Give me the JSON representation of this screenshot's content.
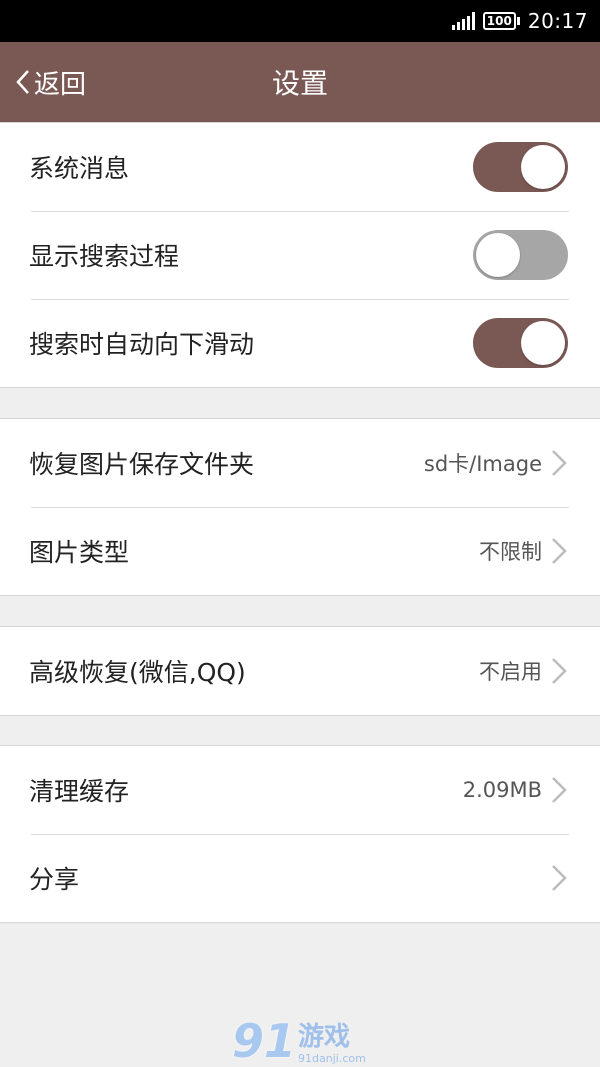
{
  "status_bar": {
    "battery": "100",
    "time": "20:17"
  },
  "navbar": {
    "back_label": "返回",
    "title": "设置"
  },
  "colors": {
    "accent": "#7a5955",
    "toggle_off": "#a6a6a6",
    "background": "#efefef"
  },
  "groups": [
    {
      "rows": [
        {
          "label": "系统消息",
          "toggle": true
        },
        {
          "label": "显示搜索过程",
          "toggle": false
        },
        {
          "label": "搜索时自动向下滑动",
          "toggle": true
        }
      ]
    },
    {
      "rows": [
        {
          "label": "恢复图片保存文件夹",
          "value": "sd卡/Image"
        },
        {
          "label": "图片类型",
          "value": "不限制"
        }
      ]
    },
    {
      "rows": [
        {
          "label": "高级恢复(微信,QQ)",
          "value": "不启用"
        }
      ]
    },
    {
      "rows": [
        {
          "label": "清理缓存",
          "value": "2.09MB"
        },
        {
          "label": "分享",
          "value": ""
        }
      ]
    }
  ],
  "watermark": {
    "number": "91",
    "name": "游戏",
    "url": "91danji.com"
  }
}
